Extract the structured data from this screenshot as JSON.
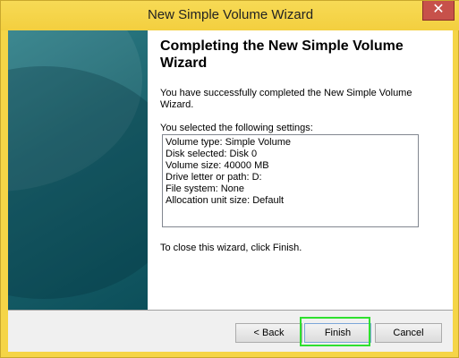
{
  "window": {
    "title": "New Simple Volume Wizard",
    "close_glyph": "✕"
  },
  "page": {
    "heading": "Completing the New Simple Volume Wizard",
    "intro": "You have successfully completed the New Simple Volume Wizard.",
    "settings_label": "You selected the following settings:",
    "settings": [
      "Volume type: Simple Volume",
      "Disk selected: Disk 0",
      "Volume size: 40000 MB",
      "Drive letter or path: D:",
      "File system: None",
      "Allocation unit size: Default"
    ],
    "close_note": "To close this wizard, click Finish."
  },
  "buttons": {
    "back": "< Back",
    "finish": "Finish",
    "cancel": "Cancel"
  },
  "colors": {
    "title_bar": "#f3cf3f",
    "panel": "#1d6670",
    "highlight": "#2fe02f"
  }
}
